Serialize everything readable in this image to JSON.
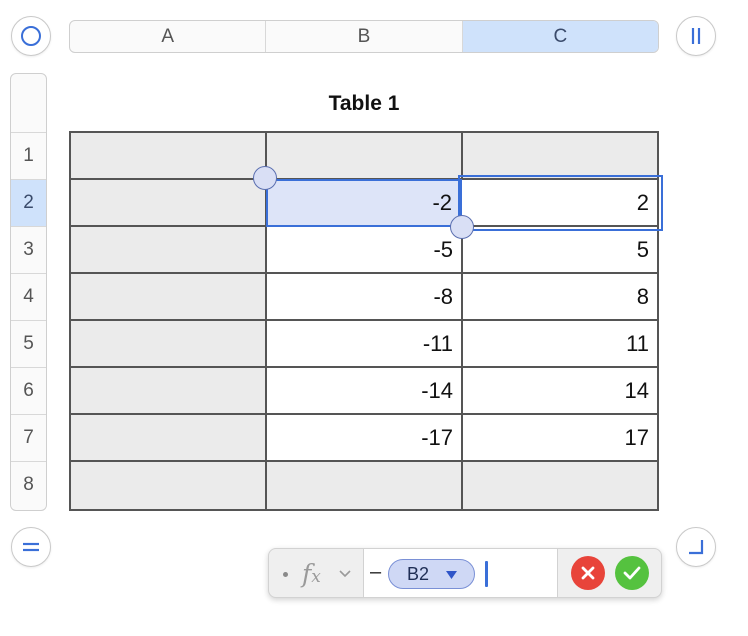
{
  "columns": [
    {
      "label": "A",
      "selected": false
    },
    {
      "label": "B",
      "selected": false
    },
    {
      "label": "C",
      "selected": true
    }
  ],
  "rows": [
    {
      "label": "1",
      "selected": false
    },
    {
      "label": "2",
      "selected": true
    },
    {
      "label": "3",
      "selected": false
    },
    {
      "label": "4",
      "selected": false
    },
    {
      "label": "5",
      "selected": false
    },
    {
      "label": "6",
      "selected": false
    },
    {
      "label": "7",
      "selected": false
    },
    {
      "label": "8",
      "selected": false
    }
  ],
  "table": {
    "title": "Table 1",
    "cells": [
      [
        "",
        "",
        ""
      ],
      [
        "",
        "-2",
        "2"
      ],
      [
        "",
        "-5",
        "5"
      ],
      [
        "",
        "-8",
        "8"
      ],
      [
        "",
        "-11",
        "11"
      ],
      [
        "",
        "-14",
        "14"
      ],
      [
        "",
        "-17",
        "17"
      ],
      [
        "",
        "",
        ""
      ]
    ]
  },
  "formula_bar": {
    "operator": "–",
    "reference_token": "B2"
  },
  "colors": {
    "accent": "#3a6fd8",
    "selection_fill": "#dde4f8",
    "header_selected": "#cfe2fb",
    "cancel": "#e8443a",
    "confirm": "#55c23f"
  },
  "icons": {
    "top_left": "circle-select-icon",
    "top_right": "freeze-columns-icon",
    "bottom_left": "add-row-icon",
    "bottom_right": "resize-corner-icon",
    "cancel": "cancel-x-icon",
    "confirm": "confirm-check-icon"
  }
}
